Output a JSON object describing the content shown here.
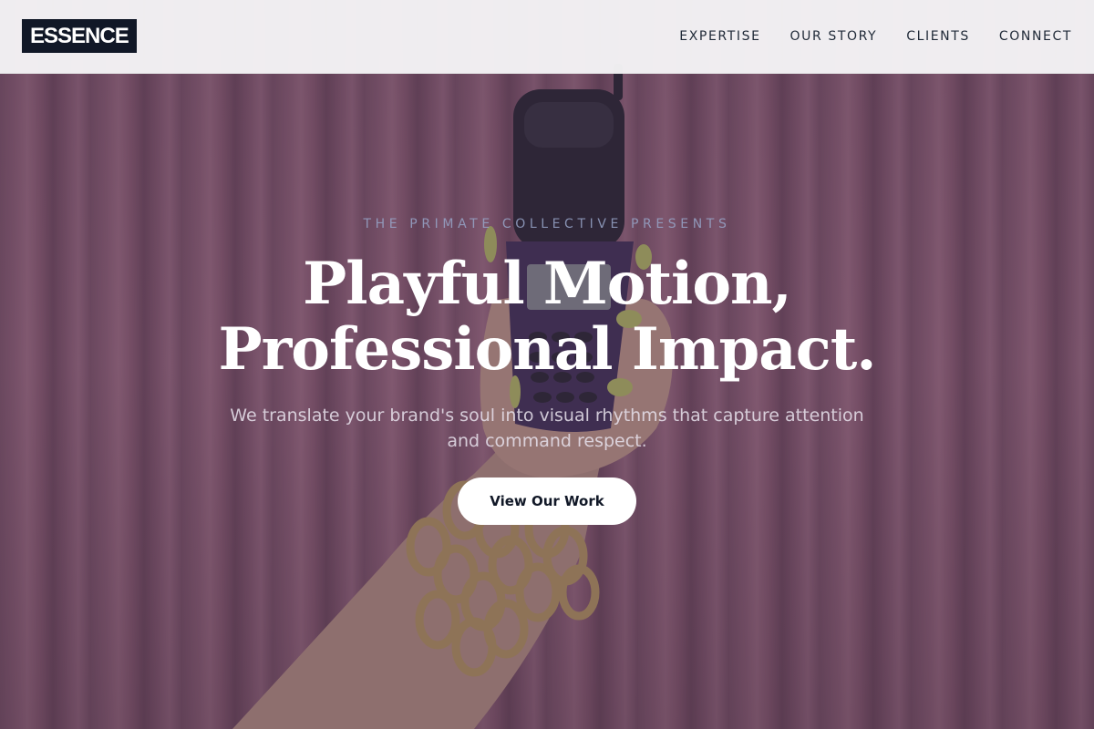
{
  "brand": {
    "logo_text": "ESSENCE",
    "logo_bg": "#111827",
    "logo_fg": "#ffffff"
  },
  "nav": {
    "items": [
      {
        "label": "EXPERTISE"
      },
      {
        "label": "OUR STORY"
      },
      {
        "label": "CLIENTS"
      },
      {
        "label": "CONNECT"
      }
    ]
  },
  "hero": {
    "eyebrow": "THE PRIMATE COLLECTIVE PRESENTS",
    "headline_line1": "Playful Motion,",
    "headline_line2": "Professional Impact.",
    "subtext": "We translate your brand's soul into visual rhythms that capture attention and command respect.",
    "cta_label": "View Our Work",
    "background_image": "hand-holding-flip-phone-photo"
  },
  "colors": {
    "header_bg": "#f4f3f5",
    "nav_text": "#1f2937",
    "headline": "#ffffff",
    "cta_bg": "#ffffff",
    "cta_text": "#111827"
  }
}
